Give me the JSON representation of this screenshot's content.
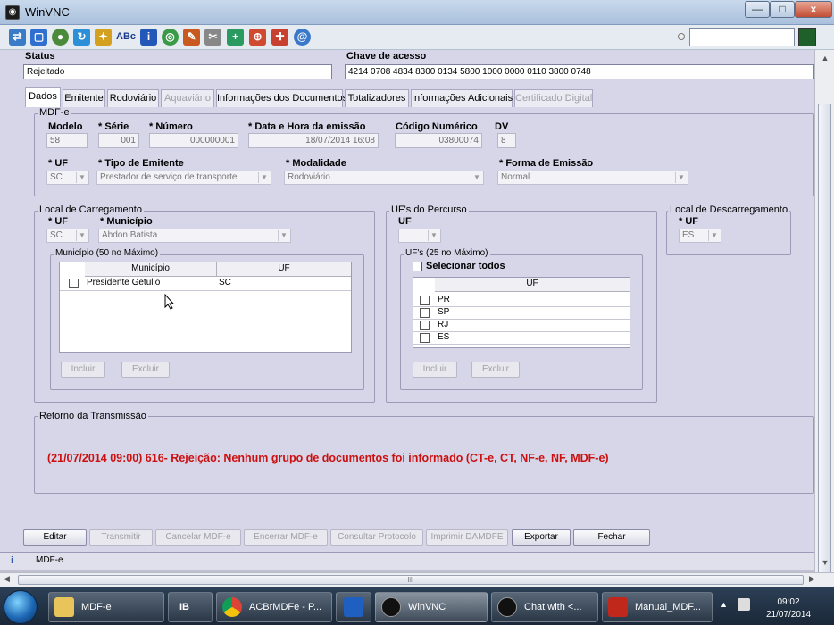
{
  "window": {
    "title": "WinVNC",
    "min": "—",
    "max": "□",
    "close": "x"
  },
  "toolbar": {
    "icons": [
      "connection-icon",
      "fullscreen-icon",
      "refresh-icon",
      "options-icon",
      "send-ctrl-alt-del-icon",
      "font-icon",
      "info-icon",
      "transfer-icon",
      "chat-icon",
      "tools-icon",
      "zoom-in-icon",
      "zoom-out-icon",
      "record-icon",
      "help-icon"
    ],
    "input_value": ""
  },
  "top": {
    "status_label": "Status",
    "status_value": "Rejeitado",
    "chave_label": "Chave de acesso",
    "chave_value": "4214 0708 4834 8300 0134 5800 1000 0000 0110 3800 0748"
  },
  "tabs": [
    {
      "label": "Dados",
      "state": "active"
    },
    {
      "label": "Emitente",
      "state": "normal"
    },
    {
      "label": "Rodoviário",
      "state": "normal"
    },
    {
      "label": "Aquaviário",
      "state": "disabled"
    },
    {
      "label": "Informações dos Documentos",
      "state": "normal"
    },
    {
      "label": "Totalizadores",
      "state": "normal"
    },
    {
      "label": "Informações Adicionais",
      "state": "normal"
    },
    {
      "label": "Certificado Digital",
      "state": "disabled"
    }
  ],
  "mdfe": {
    "group_label": "MDF-e",
    "modelo_label": "Modelo",
    "modelo": "58",
    "serie_label": "* Série",
    "serie": "001",
    "numero_label": "* Número",
    "numero": "000000001",
    "data_label": "* Data e Hora da emissão",
    "data": "18/07/2014 16:08",
    "codigo_label": "Código Numérico",
    "codigo": "03800074",
    "dv_label": "DV",
    "dv": "8",
    "uf_label": "* UF",
    "uf": "SC",
    "tipo_label": "* Tipo de Emitente",
    "tipo": "Prestador de serviço de transporte",
    "modalidade_label": "* Modalidade",
    "modalidade": "Rodoviário",
    "forma_label": "* Forma de Emissão",
    "forma": "Normal"
  },
  "carregamento": {
    "group_label": "Local de Carregamento",
    "uf_label": "* UF",
    "uf": "SC",
    "municipio_label": "* Município",
    "municipio": "Abdon Batista",
    "sub_label": "Município (50 no Máximo)",
    "col_municipio": "Município",
    "col_uf": "UF",
    "rows": [
      {
        "municipio": "Presidente Getulio",
        "uf": "SC"
      }
    ],
    "incluir": "Incluir",
    "excluir": "Excluir"
  },
  "percurso": {
    "group_label": "UF's do Percurso",
    "uf_label": "UF",
    "uf": "",
    "sub_label": "UF's (25 no Máximo)",
    "select_all": "Selecionar todos",
    "col_uf": "UF",
    "rows": [
      "PR",
      "SP",
      "RJ",
      "ES"
    ],
    "incluir": "Incluir",
    "excluir": "Excluir"
  },
  "descarregamento": {
    "group_label": "Local de Descarregamento",
    "uf_label": "* UF",
    "uf": "ES"
  },
  "retorno": {
    "group_label": "Retorno da Transmissão",
    "message": "(21/07/2014 09:00) 616- Rejeição: Nenhum grupo de documentos foi informado (CT-e, CT, NF-e, NF, MDF-e)",
    "message_color": "#cc1010"
  },
  "actions": {
    "editar": "Editar",
    "transmitir": "Transmitir",
    "cancelar": "Cancelar MDF-e",
    "encerrar": "Encerrar MDF-e",
    "consultar": "Consultar Protocolo",
    "imprimir": "Imprimir DAMDFE",
    "exportar": "Exportar",
    "fechar": "Fechar"
  },
  "statusbar": {
    "text": "MDF-e"
  },
  "hscroll": {
    "grip": "III"
  },
  "taskbar": {
    "items": [
      {
        "label": "MDF-e",
        "icon": "folder-icon"
      },
      {
        "label": "IB",
        "icon": "ib-icon"
      },
      {
        "label": "ACBrMDFe - P...",
        "icon": "chrome-icon"
      },
      {
        "label": "",
        "icon": "outlook-icon"
      },
      {
        "label": "WinVNC",
        "icon": "vnc-icon"
      },
      {
        "label": "Chat with <...",
        "icon": "vnc-chat-icon"
      },
      {
        "label": "Manual_MDF...",
        "icon": "pdf-icon"
      }
    ],
    "time": "09:02",
    "date": "21/07/2014"
  }
}
